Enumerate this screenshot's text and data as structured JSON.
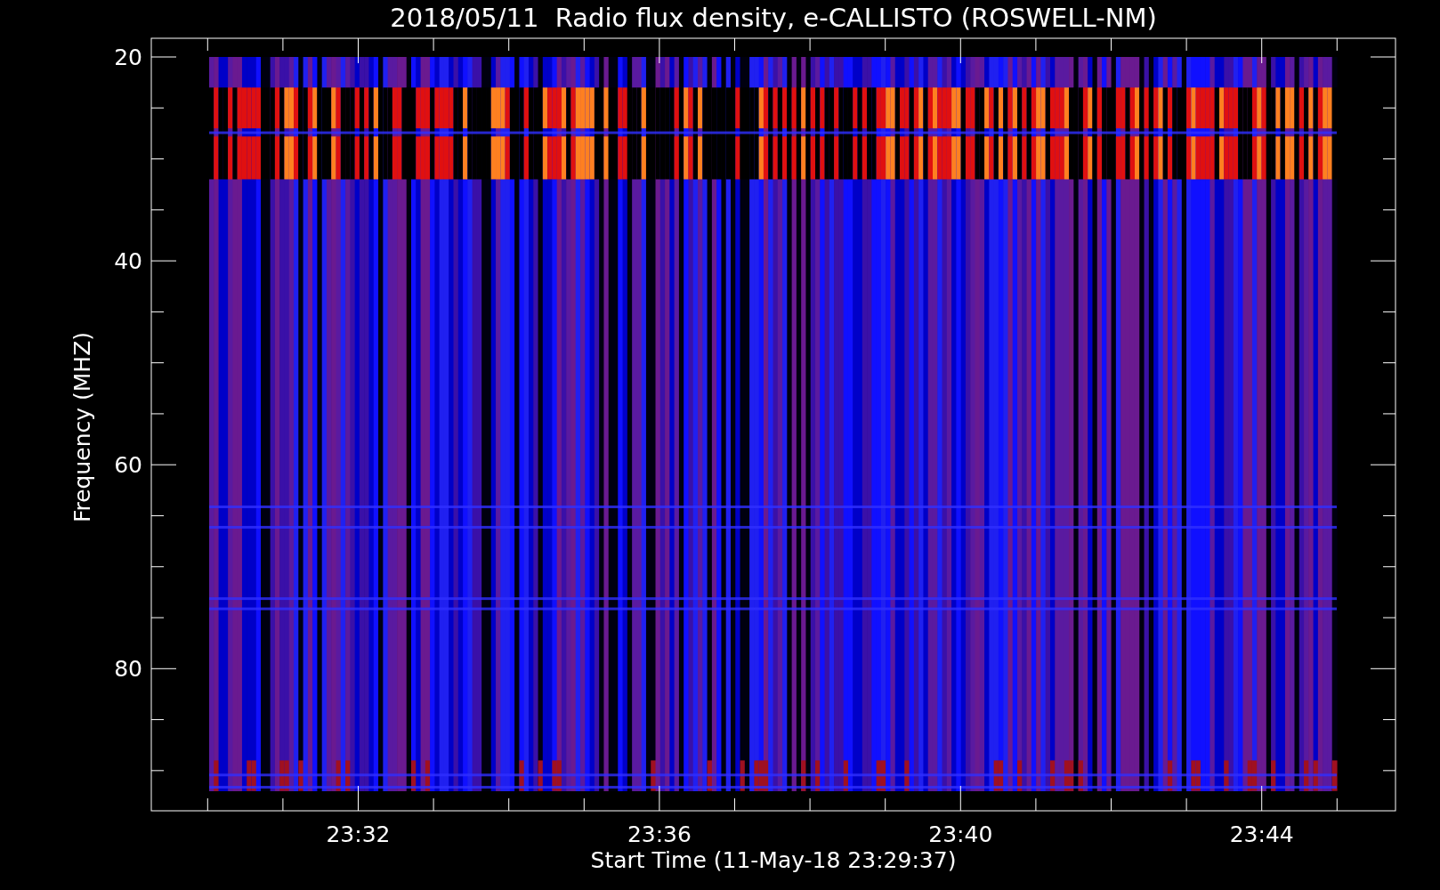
{
  "title": "2018/05/11  Radio flux density, e-CALLISTO (ROSWELL-NM)",
  "ylabel": "Frequency (MHZ)",
  "xlabel": "Start Time (11-May-18 23:29:37)",
  "yticks": [
    "20",
    "40",
    "60",
    "80"
  ],
  "xticks": [
    "23:32",
    "23:36",
    "23:40",
    "23:44"
  ]
}
